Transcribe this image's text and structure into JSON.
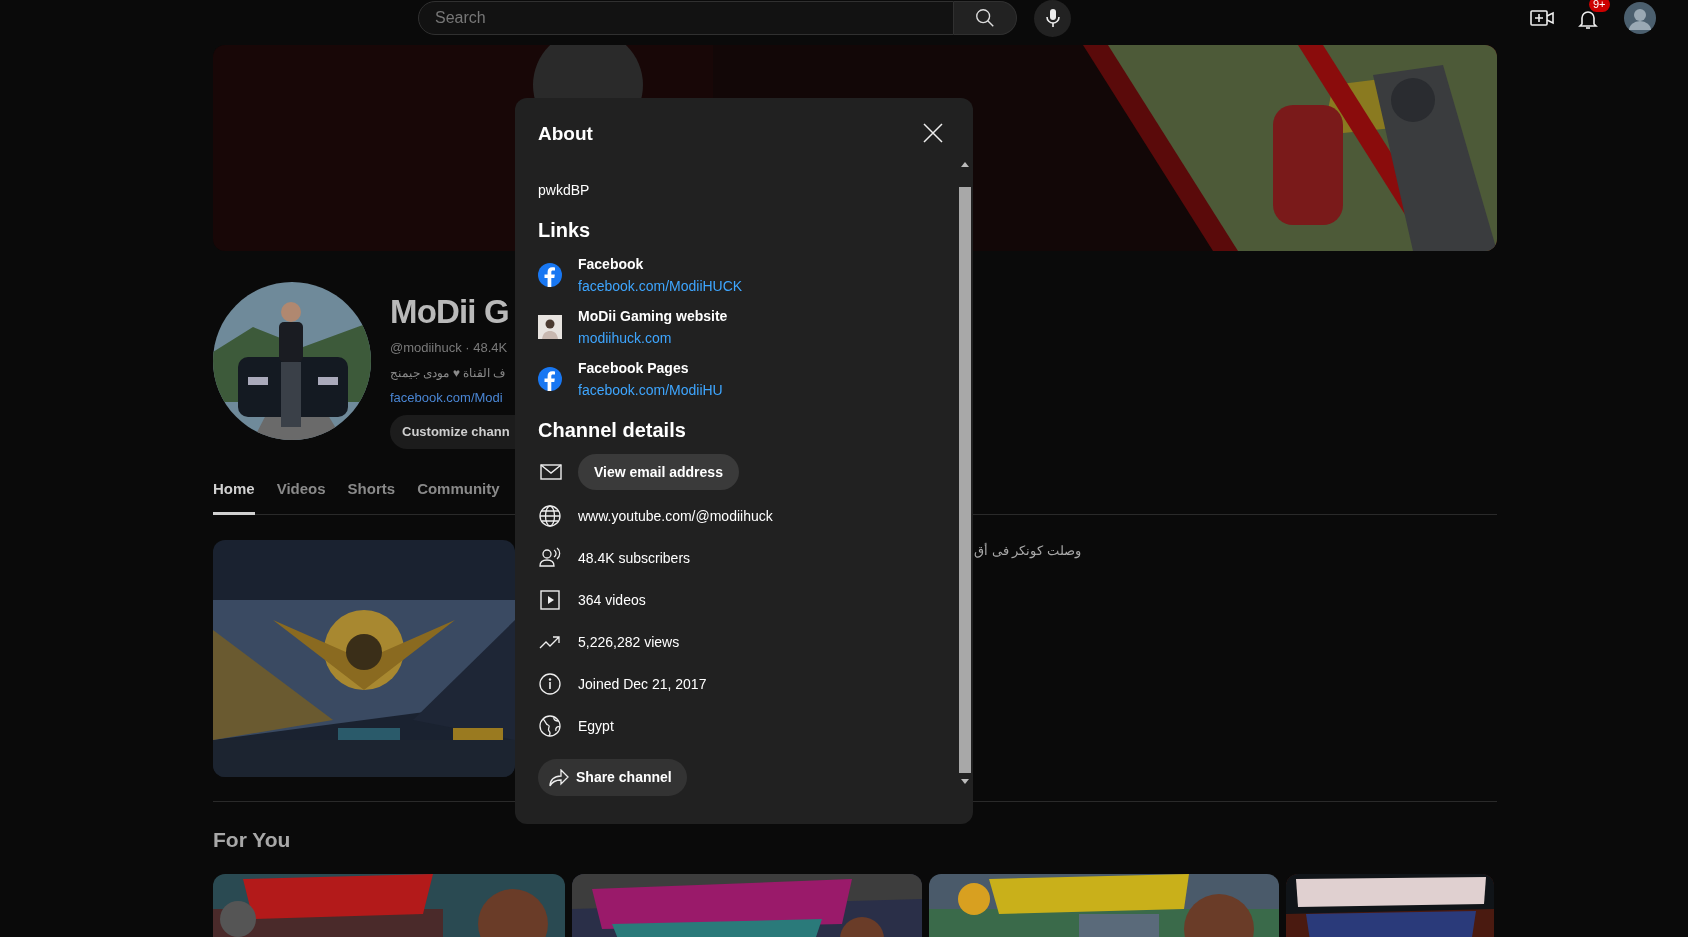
{
  "topbar": {
    "search": {
      "placeholder": "Search"
    },
    "notification_count": "9+"
  },
  "channel": {
    "name": "MoDii G",
    "handle": "@modiihuck · 48.4K",
    "description": "ف القناة ♥ مودى جيمنج",
    "link": "facebook.com/Modi",
    "customize_button": "Customize chann"
  },
  "tabs": [
    {
      "label": "Home",
      "selected": true
    },
    {
      "label": "Videos",
      "selected": false
    },
    {
      "label": "Shorts",
      "selected": false
    },
    {
      "label": "Community",
      "selected": false
    }
  ],
  "featured_video": {
    "title": "وصلت كونكر فى أق"
  },
  "for_you": {
    "heading": "For You"
  },
  "about_dialog": {
    "title": "About",
    "description": "pwkdBP",
    "links_heading": "Links",
    "links": [
      {
        "kind": "facebook",
        "title": "Facebook",
        "url": "facebook.com/ModiiHUCK"
      },
      {
        "kind": "site",
        "title": "MoDii Gaming website",
        "url": "modiihuck.com"
      },
      {
        "kind": "facebook",
        "title": "Facebook Pages",
        "url": "facebook.com/ModiiHU"
      }
    ],
    "details_heading": "Channel details",
    "email_button": "View email address",
    "details": [
      {
        "kind": "web",
        "text": "www.youtube.com/@modiihuck"
      },
      {
        "kind": "subscribers",
        "text": "48.4K subscribers"
      },
      {
        "kind": "videos",
        "text": "364 videos"
      },
      {
        "kind": "views",
        "text": "5,226,282 views"
      },
      {
        "kind": "joined",
        "text": "Joined Dec 21, 2017"
      },
      {
        "kind": "country",
        "text": "Egypt"
      }
    ],
    "share_button": "Share channel"
  }
}
